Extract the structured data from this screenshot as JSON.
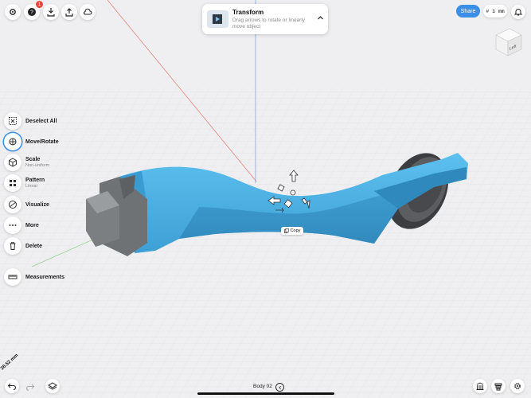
{
  "toolbar_left": {
    "icons": [
      "gear-shaped-settings-icon",
      "help-icon",
      "import-icon",
      "export-icon",
      "cloud-icon"
    ],
    "help_badge": "1"
  },
  "transform_card": {
    "title": "Transform",
    "description": "Drag arrows to rotate or linearly move object"
  },
  "top_right": {
    "share_label": "Share",
    "units_label": "# 1 mm"
  },
  "view_cube": {
    "face_label": "Left"
  },
  "tools": [
    {
      "label": "Deselect All",
      "sub": ""
    },
    {
      "label": "Move/Rotate",
      "sub": ""
    },
    {
      "label": "Scale",
      "sub": "Non-uniform"
    },
    {
      "label": "Pattern",
      "sub": "Linear"
    },
    {
      "label": "Visualize",
      "sub": ""
    },
    {
      "label": "More",
      "sub": ""
    },
    {
      "label": "Delete",
      "sub": ""
    },
    {
      "label": "Measurements",
      "sub": ""
    }
  ],
  "copy_chip": {
    "label": "Copy"
  },
  "bottom": {
    "body_name": "Body 02",
    "measurement_value": "38.52 mm"
  },
  "colors": {
    "accent": "#3b8fe6",
    "part_blue": "#4aaee0",
    "part_gray": "#6f7275",
    "badge": "#e8453c"
  }
}
